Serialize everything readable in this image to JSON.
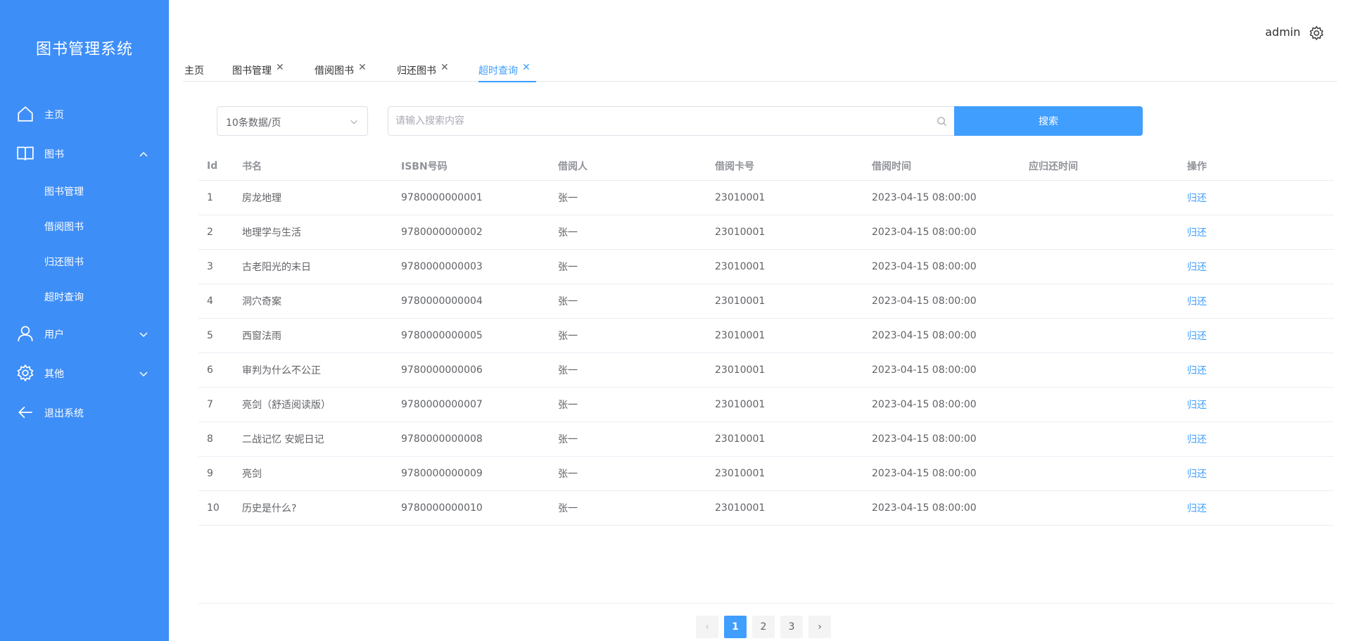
{
  "app": {
    "title": "图书管理系统"
  },
  "sidebar": {
    "home": "主页",
    "books": "图书",
    "book_sub": [
      "图书管理",
      "借阅图书",
      "归还图书",
      "超时查询"
    ],
    "users": "用户",
    "other": "其他",
    "logout": "退出系统"
  },
  "header": {
    "user": "admin"
  },
  "tabs": [
    "主页",
    "图书管理",
    "借阅图书",
    "归还图书",
    "超时查询"
  ],
  "toolbar": {
    "page_size": "10条数据/页",
    "search_placeholder": "请输入搜索内容",
    "search_label": "搜索"
  },
  "table": {
    "columns": [
      "Id",
      "书名",
      "ISBN号码",
      "借阅人",
      "借阅卡号",
      "借阅时间",
      "应归还时间",
      "操作"
    ],
    "rows": [
      {
        "id": "1",
        "name": "房龙地理",
        "isbn": "9780000000001",
        "borrower": "张一",
        "card": "23010001",
        "time": "2023-04-15 08:00:00",
        "due": "",
        "action": "归还"
      },
      {
        "id": "2",
        "name": "地理学与生活",
        "isbn": "9780000000002",
        "borrower": "张一",
        "card": "23010001",
        "time": "2023-04-15 08:00:00",
        "due": "",
        "action": "归还"
      },
      {
        "id": "3",
        "name": "古老阳光的末日",
        "isbn": "9780000000003",
        "borrower": "张一",
        "card": "23010001",
        "time": "2023-04-15 08:00:00",
        "due": "",
        "action": "归还"
      },
      {
        "id": "4",
        "name": "洞穴奇案",
        "isbn": "9780000000004",
        "borrower": "张一",
        "card": "23010001",
        "time": "2023-04-15 08:00:00",
        "due": "",
        "action": "归还"
      },
      {
        "id": "5",
        "name": "西窗法雨",
        "isbn": "9780000000005",
        "borrower": "张一",
        "card": "23010001",
        "time": "2023-04-15 08:00:00",
        "due": "",
        "action": "归还"
      },
      {
        "id": "6",
        "name": "审判为什么不公正",
        "isbn": "9780000000006",
        "borrower": "张一",
        "card": "23010001",
        "time": "2023-04-15 08:00:00",
        "due": "",
        "action": "归还"
      },
      {
        "id": "7",
        "name": "亮剑（舒适阅读版）",
        "isbn": "9780000000007",
        "borrower": "张一",
        "card": "23010001",
        "time": "2023-04-15 08:00:00",
        "due": "",
        "action": "归还"
      },
      {
        "id": "8",
        "name": "二战记忆 安妮日记",
        "isbn": "9780000000008",
        "borrower": "张一",
        "card": "23010001",
        "time": "2023-04-15 08:00:00",
        "due": "",
        "action": "归还"
      },
      {
        "id": "9",
        "name": "亮剑",
        "isbn": "9780000000009",
        "borrower": "张一",
        "card": "23010001",
        "time": "2023-04-15 08:00:00",
        "due": "",
        "action": "归还"
      },
      {
        "id": "10",
        "name": "历史是什么?",
        "isbn": "9780000000010",
        "borrower": "张一",
        "card": "23010001",
        "time": "2023-04-15 08:00:00",
        "due": "",
        "action": "归还"
      }
    ]
  },
  "pagination": {
    "prev": "‹",
    "pages": [
      "1",
      "2",
      "3"
    ],
    "next": "›",
    "current": "1"
  },
  "colors": {
    "sidebar": "#3e8ef7",
    "accent": "#409eff"
  }
}
